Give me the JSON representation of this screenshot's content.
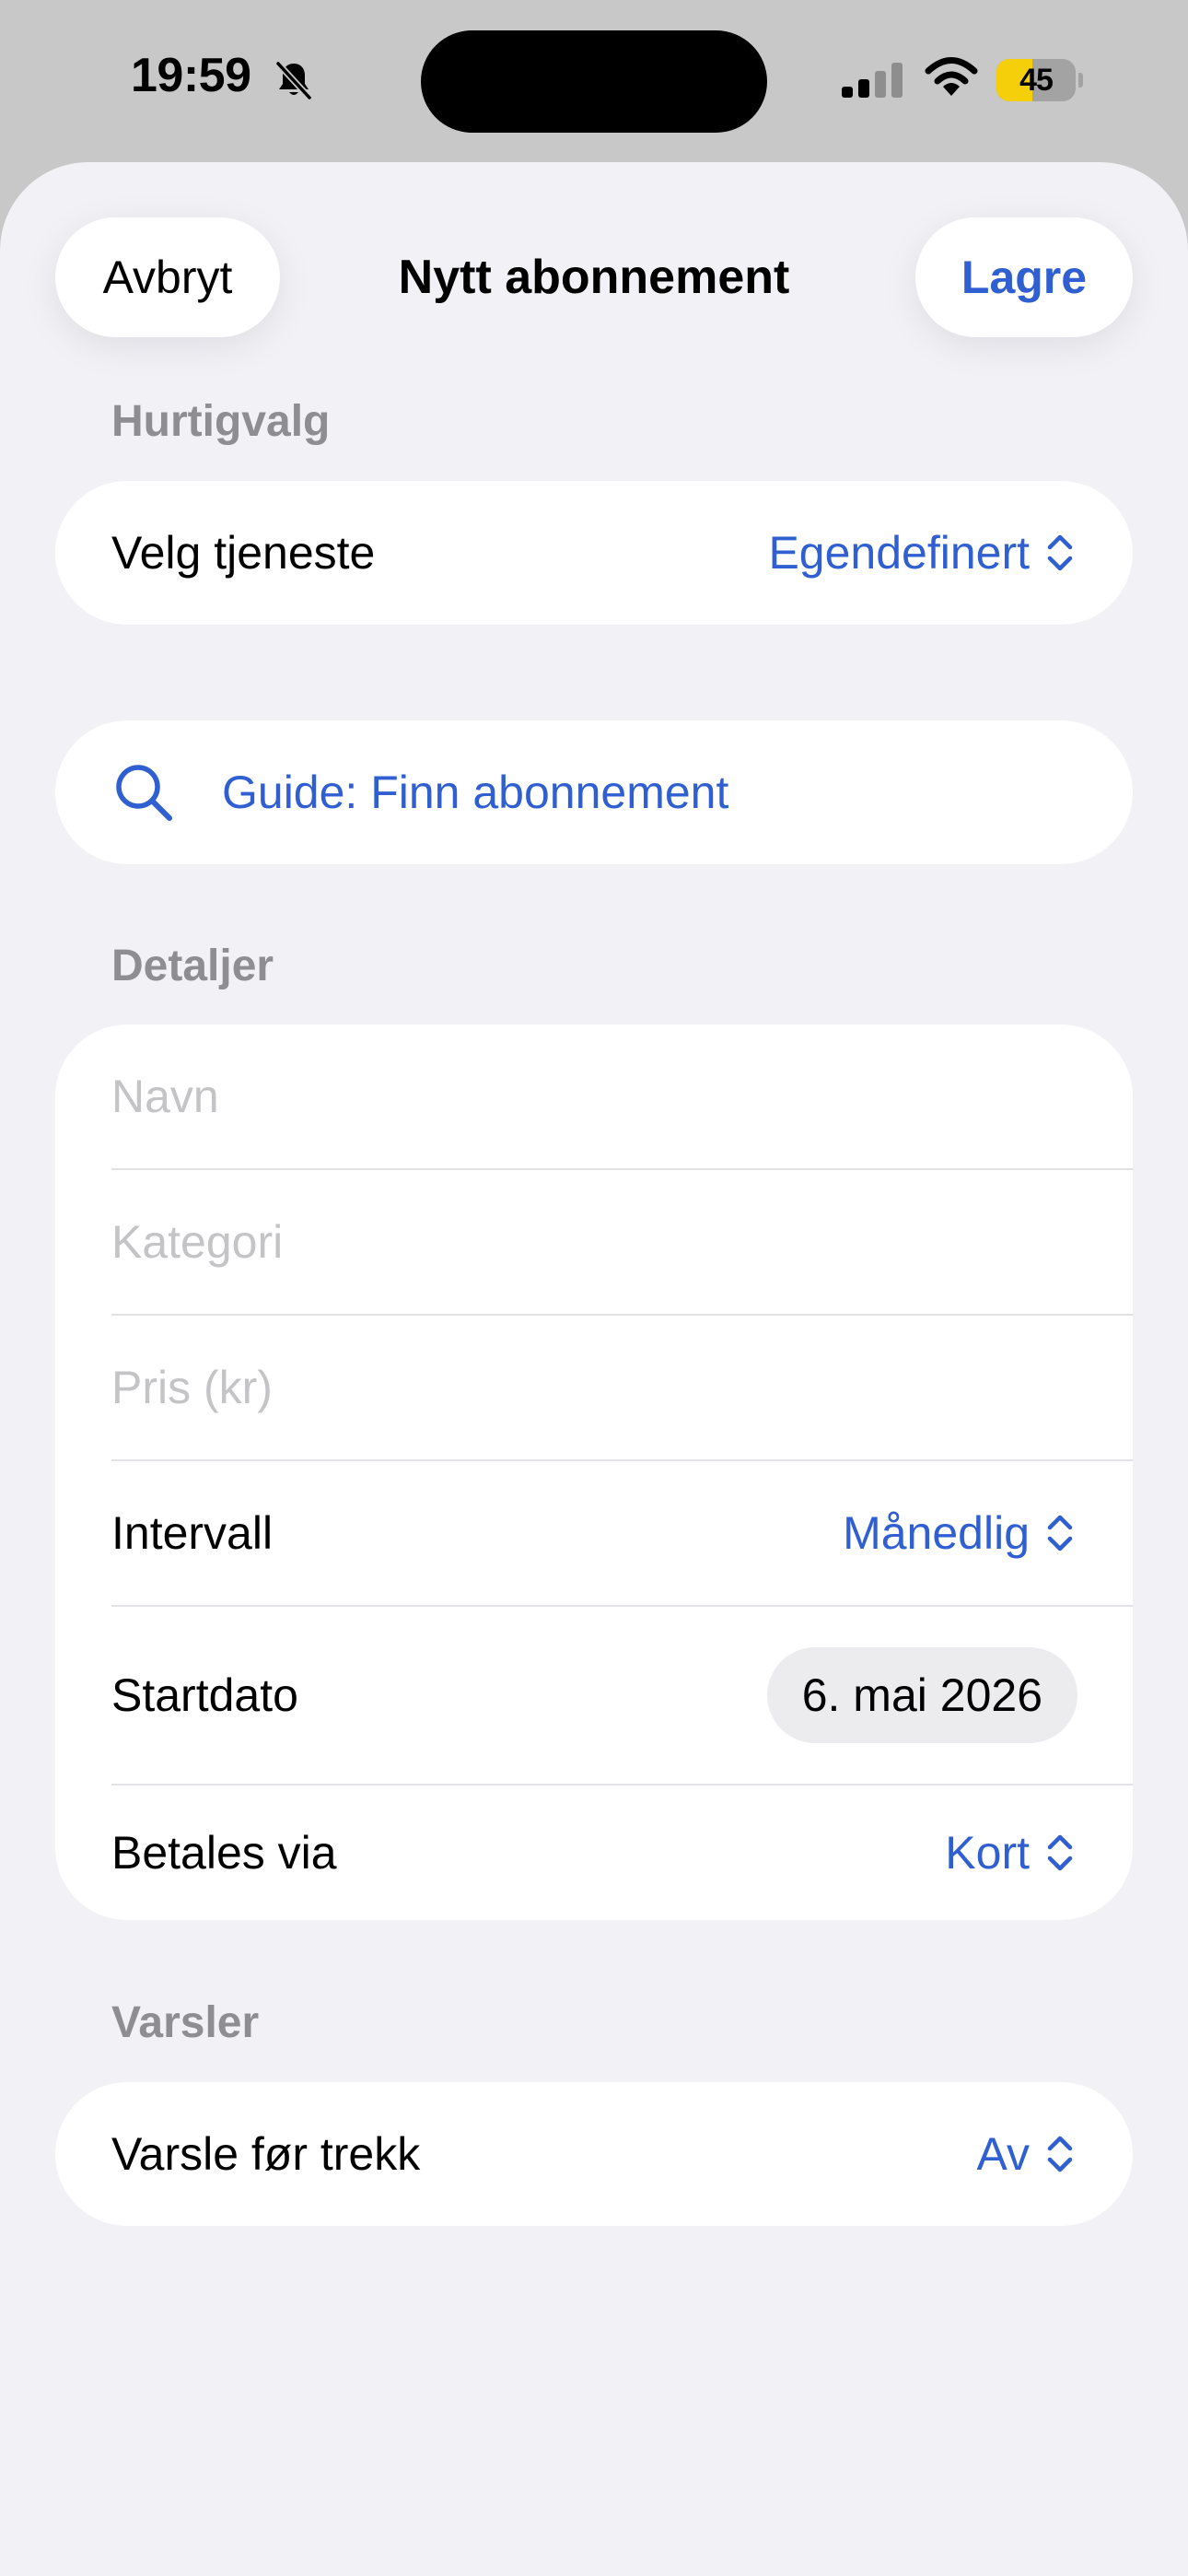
{
  "status_bar": {
    "time": "19:59",
    "battery_percent": "45",
    "battery_level": 0.45,
    "icons": [
      "bell-slash-icon",
      "cellular-signal-icon",
      "wifi-icon",
      "battery-charging-icon"
    ]
  },
  "nav": {
    "cancel_label": "Avbryt",
    "title": "Nytt abonnement",
    "save_label": "Lagre"
  },
  "quick_choice": {
    "header": "Hurtigvalg",
    "service_label": "Velg tjeneste",
    "service_value": "Egendefinert"
  },
  "guide": {
    "label": "Guide: Finn abonnement",
    "icon": "search-icon"
  },
  "details": {
    "header": "Detaljer",
    "name_placeholder": "Navn",
    "category_placeholder": "Kategori",
    "price_placeholder": "Pris (kr)",
    "interval_label": "Intervall",
    "interval_value": "Månedlig",
    "start_date_label": "Startdato",
    "start_date_value": "6. mai 2026",
    "payment_label": "Betales via",
    "payment_value": "Kort"
  },
  "notifications": {
    "header": "Varsler",
    "notify_label": "Varsle før trekk",
    "notify_value": "Av"
  },
  "colors": {
    "accent": "#2f5fd0",
    "background": "#f1f1f6",
    "card": "#ffffff",
    "section_header": "#8d8d92",
    "placeholder": "#c4c4c7",
    "battery": "#f4cf0a"
  }
}
